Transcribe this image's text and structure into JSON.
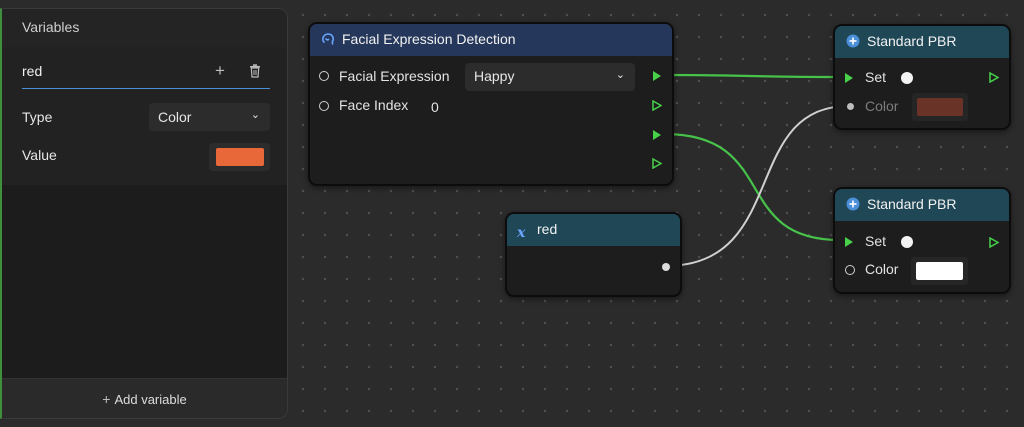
{
  "variables_panel": {
    "title": "Variables",
    "variable": {
      "name": "red",
      "type_label": "Type",
      "type_value": "Color",
      "value_label": "Value",
      "value_color": "#e8683a"
    },
    "add_variable_label": "Add variable"
  },
  "nodes": {
    "facial": {
      "title": "Facial Expression Detection",
      "expression_label": "Facial Expression",
      "expression_value": "Happy",
      "face_index_label": "Face Index",
      "face_index_value": "0"
    },
    "variable_node": {
      "title": "red"
    },
    "pbr_top": {
      "title": "Standard PBR",
      "set_label": "Set",
      "color_label": "Color",
      "color_value": "#6a3328"
    },
    "pbr_bottom": {
      "title": "Standard PBR",
      "set_label": "Set",
      "color_label": "Color",
      "color_value": "#ffffff"
    }
  },
  "colors": {
    "accent_blue": "#4a8fd8",
    "flow_green": "#47d24a",
    "data_wire": "#cfcfcf"
  }
}
